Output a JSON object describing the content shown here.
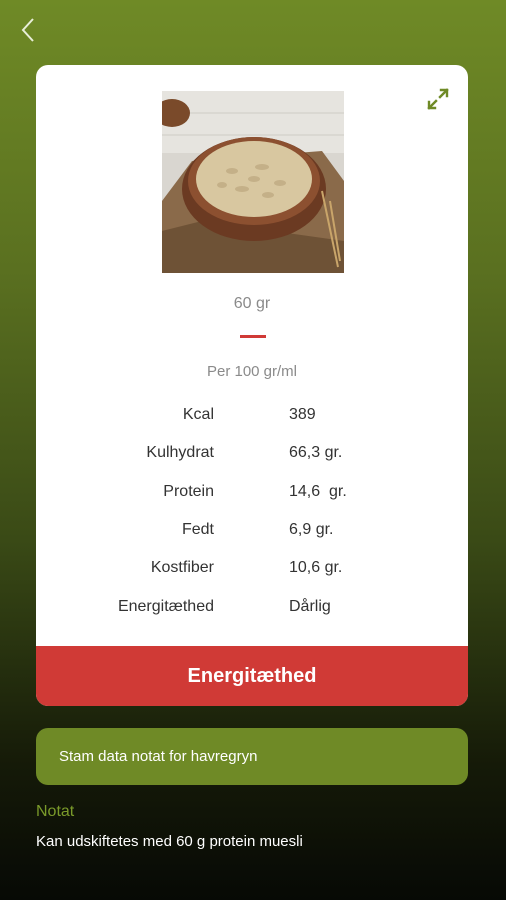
{
  "header": {
    "back_icon": "chevron-left-icon"
  },
  "card": {
    "expand_icon": "expand-icon",
    "image": "oat-flakes-bowl",
    "amount": "60 gr",
    "per_label": "Per 100 gr/ml",
    "nutrition": [
      {
        "label": "Kcal",
        "value": "389"
      },
      {
        "label": "Kulhydrat",
        "value": "66,3 gr."
      },
      {
        "label": "Protein",
        "value": "14,6  gr."
      },
      {
        "label": "Fedt",
        "value": "6,9 gr."
      },
      {
        "label": "Kostfiber",
        "value": "10,6 gr."
      },
      {
        "label": "Energitæthed",
        "value": "Dårlig"
      }
    ],
    "energy_button": "Energitæthed"
  },
  "note_button": "Stam data notat for havregryn",
  "notat": {
    "label": "Notat",
    "text": "Kan udskiftetes med 60 g protein muesli"
  },
  "colors": {
    "accent_green": "#6f8a26",
    "accent_red": "#d03a36"
  }
}
